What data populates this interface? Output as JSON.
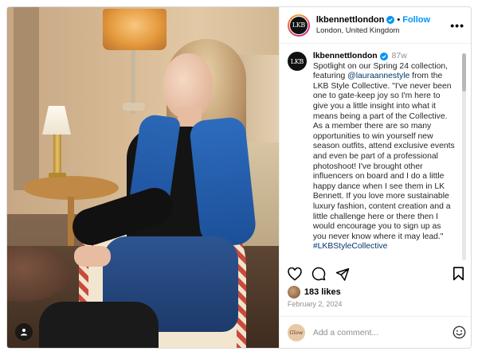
{
  "header": {
    "avatar_text": "LKB",
    "username": "lkbennettlondon",
    "separator": "•",
    "follow_label": "Follow",
    "location": "London, United Kingdom",
    "more_label": "•••"
  },
  "caption": {
    "avatar_text": "LKB",
    "username": "lkbennettlondon",
    "age": "87w",
    "text_1": "Spotlight on our Spring 24 collection, featuring ",
    "mention": "@lauraannestyle",
    "text_2": " from the LKB Style Collective. \"I've never been one to gate-keep joy so I'm here to give you a little insight into what it means being a part of the Collective. As a member there are so many opportunities to win yourself new season outfits, attend exclusive events and even be part of a professional photoshoot! I've brought other influencers on board and I do a little happy dance when I see them in LK Bennett. If you love more sustainable luxury fashion, content creation and a little challenge here or there then I would encourage you to sign up as you never know where it may lead.\" ",
    "hashtag": "#LKBStyleCollective"
  },
  "actions": {
    "like_icon": "heart-icon",
    "comment_icon": "comment-icon",
    "share_icon": "send-icon",
    "save_icon": "bookmark-icon"
  },
  "likes": {
    "count_label": "183 likes"
  },
  "date": "February 2, 2024",
  "comment_box": {
    "avatar_text": "Glow",
    "placeholder": "Add a comment...",
    "emoji_icon": "smiley-icon"
  },
  "colors": {
    "link_blue": "#0095f6",
    "mention_blue": "#00376b",
    "muted_gray": "#8e8e8e",
    "scarf_blue": "#2a67b5"
  }
}
